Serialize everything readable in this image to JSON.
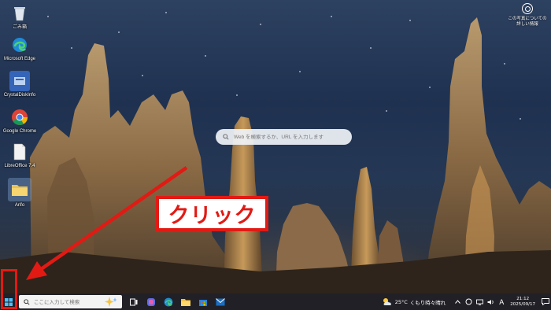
{
  "desktop_icons": [
    {
      "label": "ごみ箱",
      "icon": "recycle-bin-icon"
    },
    {
      "label": "Microsoft Edge",
      "icon": "edge-icon"
    },
    {
      "label": "CrystalDiskInfo",
      "icon": "crystaldiskinfo-icon"
    },
    {
      "label": "Google Chrome",
      "icon": "chrome-icon"
    },
    {
      "label": "LibreOffice 7.4",
      "icon": "libreoffice-icon"
    },
    {
      "label": "Arifo",
      "icon": "folder-icon"
    }
  ],
  "photo_info": {
    "line1": "この写真につい",
    "line2": "ての",
    "line3": "詳しい情報"
  },
  "web_search": {
    "placeholder": "Web を検索するか、URL を入力します"
  },
  "callout": {
    "text": "クリック"
  },
  "taskbar": {
    "search_placeholder": "ここに入力して検索",
    "pinned_apps": [
      "task-view-icon",
      "copilot-icon",
      "edge-icon",
      "file-explorer-icon",
      "store-icon",
      "mail-icon"
    ],
    "weather": {
      "temp": "25°C",
      "condition": "くもり時々晴れ"
    },
    "ime": "A",
    "clock": {
      "time": "21:12",
      "date": "2025/09/17"
    }
  },
  "colors": {
    "highlight_red": "#e11a14",
    "taskbar_bg": "#202026"
  }
}
